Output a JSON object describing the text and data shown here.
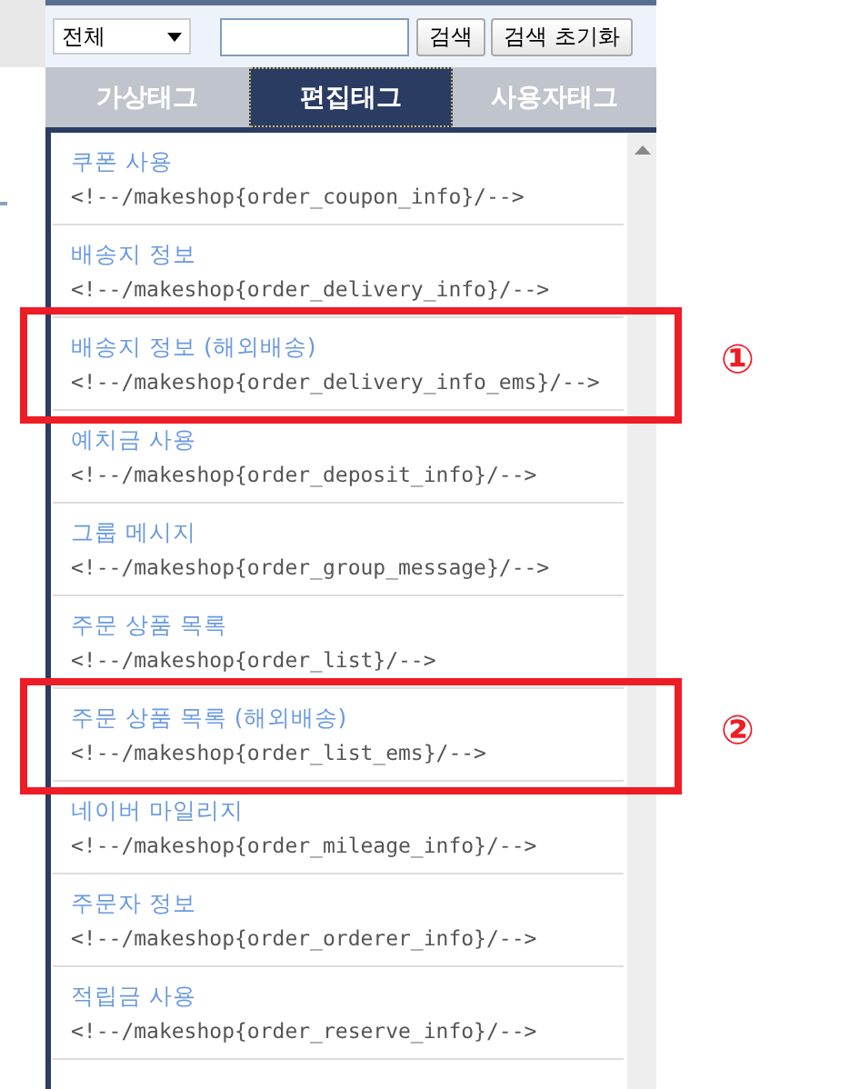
{
  "search": {
    "scope": "전체",
    "buttons": [
      "검색",
      "검색 초기화"
    ]
  },
  "tabs": [
    {
      "label": "가상태그",
      "selected": false
    },
    {
      "label": "편집태그",
      "selected": true
    },
    {
      "label": "사용자태그",
      "selected": false
    }
  ],
  "items": [
    {
      "title": "쿠폰 사용",
      "code": "<!--/makeshop{order_coupon_info}/-->"
    },
    {
      "title": "배송지 정보",
      "code": "<!--/makeshop{order_delivery_info}/-->"
    },
    {
      "title": "배송지 정보 (해외배송)",
      "code": "<!--/makeshop{order_delivery_info_ems}/-->",
      "callout": "①"
    },
    {
      "title": "예치금 사용",
      "code": "<!--/makeshop{order_deposit_info}/-->"
    },
    {
      "title": "그룹 메시지",
      "code": "<!--/makeshop{order_group_message}/-->"
    },
    {
      "title": "주문 상품 목록",
      "code": "<!--/makeshop{order_list}/-->"
    },
    {
      "title": "주문 상품 목록 (해외배송)",
      "code": "<!--/makeshop{order_list_ems}/-->",
      "callout": "②"
    },
    {
      "title": "네이버 마일리지",
      "code": "<!--/makeshop{order_mileage_info}/-->"
    },
    {
      "title": "주문자 정보",
      "code": "<!--/makeshop{order_orderer_info}/-->"
    },
    {
      "title": "적립금 사용",
      "code": "<!--/makeshop{order_reserve_info}/-->"
    }
  ]
}
